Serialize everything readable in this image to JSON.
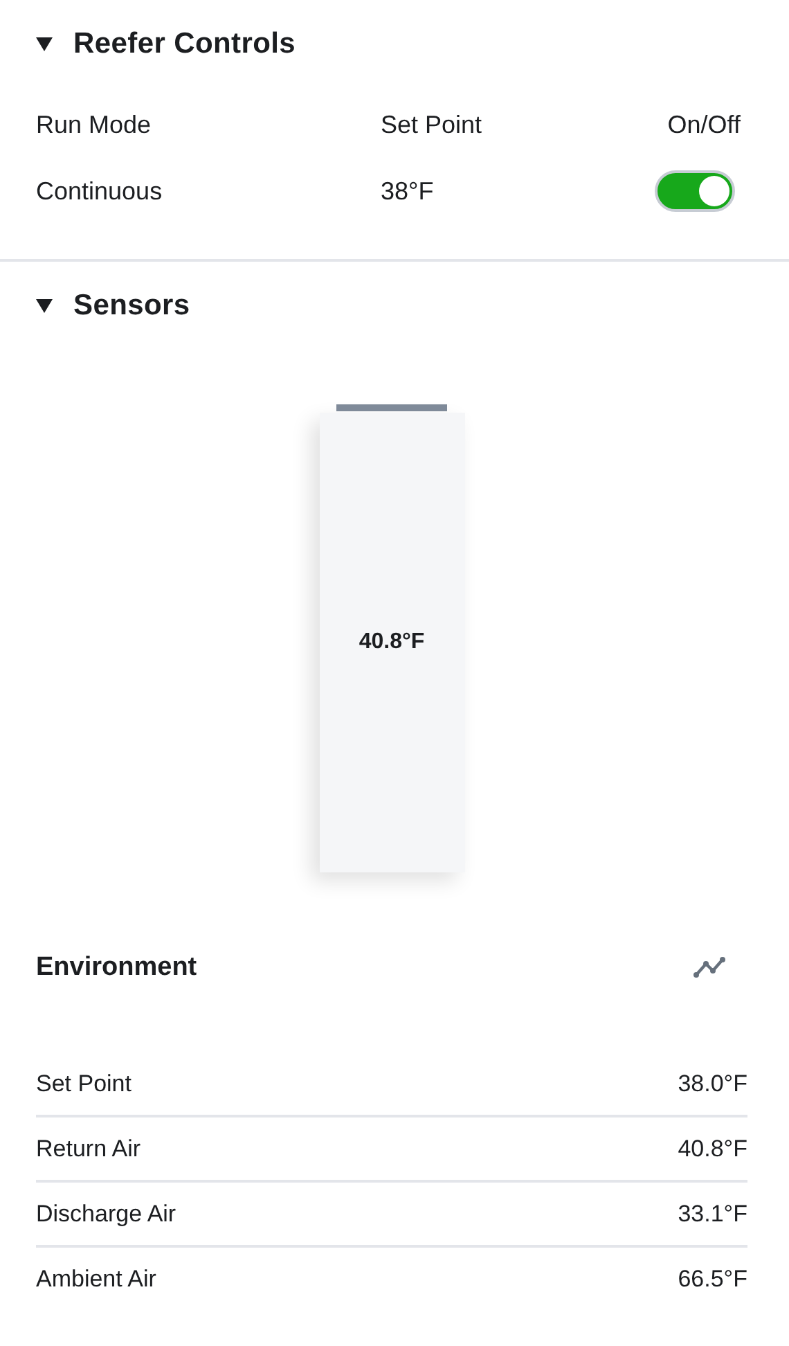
{
  "reefer_controls": {
    "title": "Reefer Controls",
    "expanded": true,
    "columns": [
      "Run Mode",
      "Set Point",
      "On/Off"
    ],
    "run_mode": "Continuous",
    "set_point": "38°F",
    "power": {
      "on": true
    }
  },
  "sensors": {
    "title": "Sensors",
    "expanded": true,
    "gauge": {
      "reading": "40.8°F"
    },
    "environment": {
      "title": "Environment",
      "rows": [
        {
          "label": "Set Point",
          "value": "38.0°F"
        },
        {
          "label": "Return Air",
          "value": "40.8°F"
        },
        {
          "label": "Discharge Air",
          "value": "33.1°F"
        },
        {
          "label": "Ambient Air",
          "value": "66.5°F"
        }
      ]
    }
  }
}
